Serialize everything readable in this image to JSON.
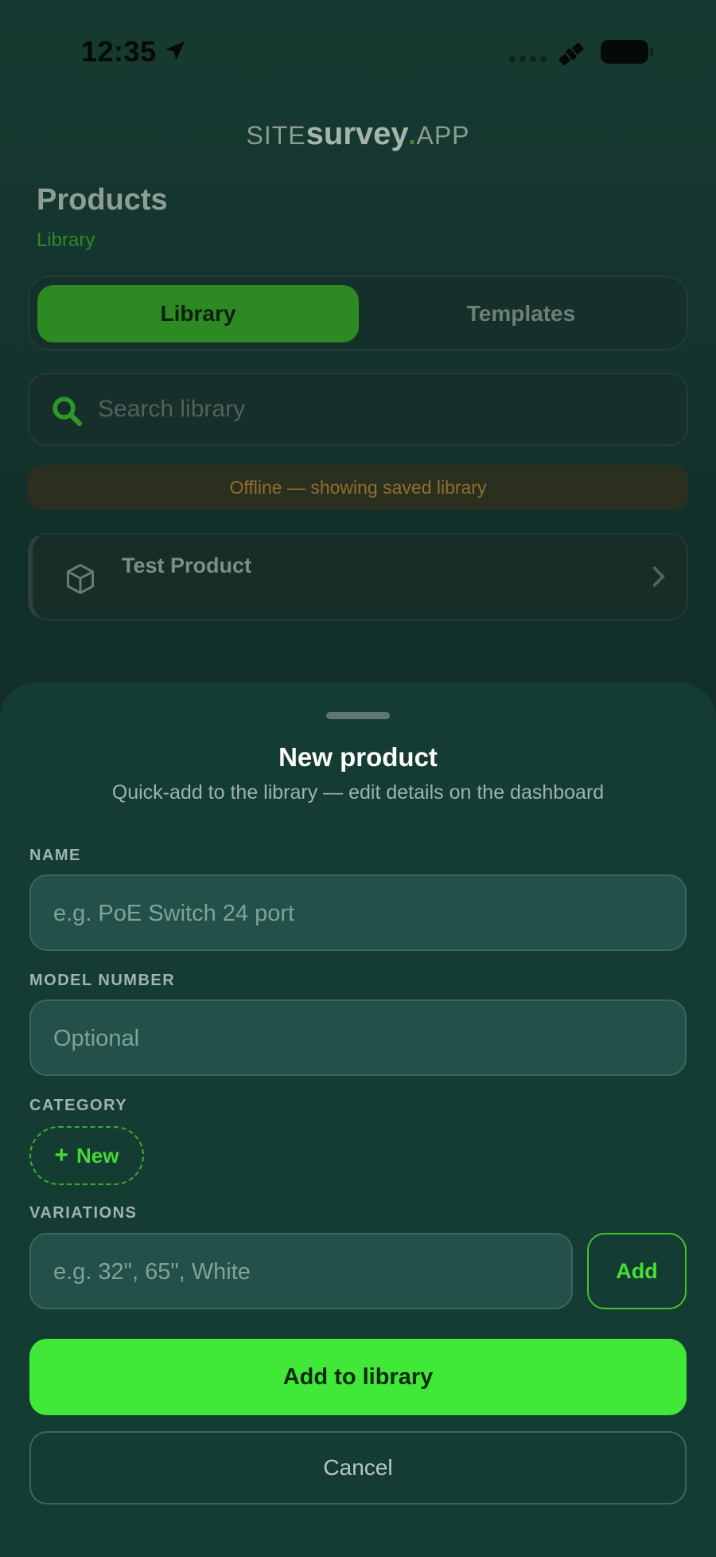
{
  "status_bar": {
    "time": "12:35",
    "icons": [
      "location-arrow-icon",
      "satellite-icon",
      "battery-icon"
    ]
  },
  "brand": {
    "prefix": "SITE",
    "name": "survey",
    "dot": ".",
    "suffix": "APP"
  },
  "header": {
    "title": "Products",
    "subtitle": "Library"
  },
  "tabs": [
    {
      "label": "Library",
      "selected": true
    },
    {
      "label": "Templates",
      "selected": false
    }
  ],
  "search": {
    "placeholder": "Search library"
  },
  "banner": {
    "text": "Offline — showing saved library"
  },
  "products": [
    {
      "name": "Test Product",
      "icon": "cube-icon"
    }
  ],
  "sheet": {
    "title": "New product",
    "subtitle": "Quick-add to the library — edit details on the dashboard",
    "fields": {
      "name": {
        "label": "NAME",
        "placeholder": "e.g. PoE Switch 24 port"
      },
      "model": {
        "label": "MODEL NUMBER",
        "placeholder": "Optional"
      },
      "category": {
        "label": "CATEGORY",
        "new_label": "New"
      },
      "variations": {
        "label": "VARIATIONS",
        "placeholder": "e.g. 32\", 65\", White",
        "add_label": "Add"
      }
    },
    "submit_label": "Add to library",
    "cancel_label": "Cancel"
  },
  "colors": {
    "accent": "#42e838",
    "background": "#153c33",
    "warning": "#8f6f2e"
  }
}
